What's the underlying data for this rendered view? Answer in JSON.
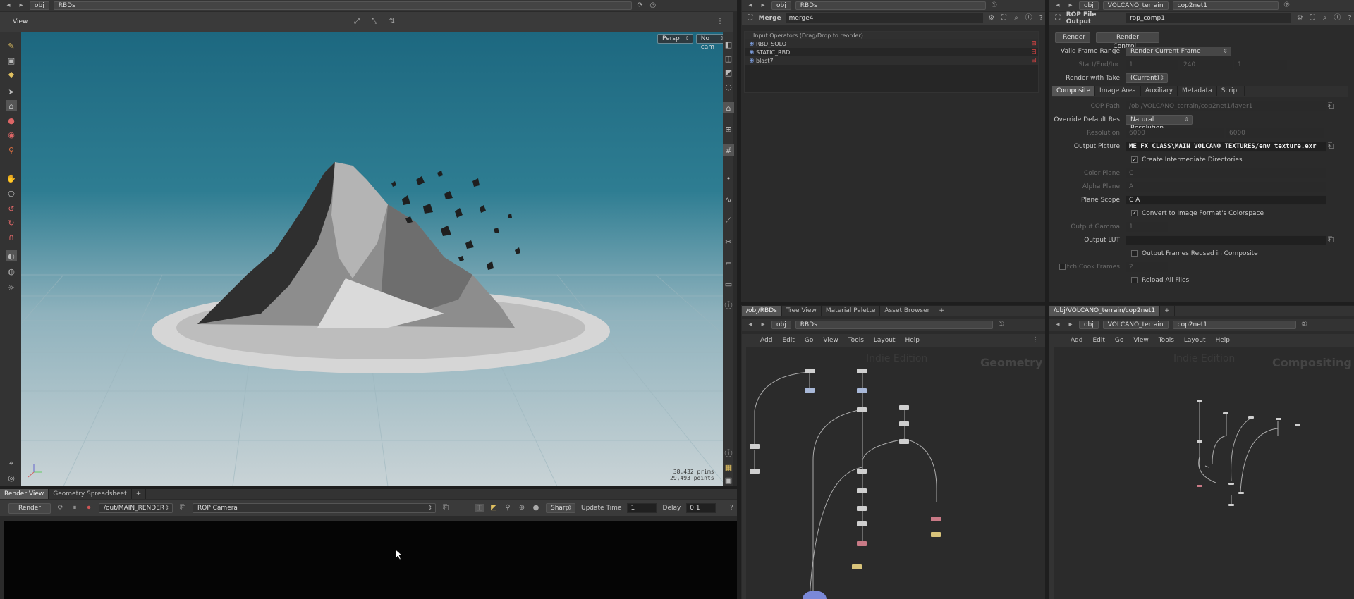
{
  "viewport_pane": {
    "path": [
      "obj",
      "RBDs"
    ],
    "tab_label": "View",
    "persp_label": "Persp",
    "cam_label": "No cam",
    "stats": [
      "38,432  prims",
      "29,493 points"
    ]
  },
  "render_view": {
    "tabs": [
      "Render View",
      "Geometry Spreadsheet"
    ],
    "render_button": "Render",
    "rop_path": "/out/MAIN_RENDER",
    "camera": "ROP Camera",
    "sharp_label": "Sharp",
    "update_time_label": "Update Time",
    "update_time_value": "1",
    "delay_label": "Delay",
    "delay_value": "0.1"
  },
  "merge_pane": {
    "path": [
      "obj",
      "RBDs"
    ],
    "node_type": "Merge",
    "node_name": "merge4",
    "list_header": "Input Operators (Drag/Drop to reorder)",
    "inputs": [
      "RBD_SOLO",
      "STATIC_RBD",
      "blast7"
    ]
  },
  "rop_pane": {
    "path": [
      "obj",
      "VOLCANO_terrain",
      "cop2net1"
    ],
    "node_type": "ROP File Output",
    "node_name": "rop_comp1",
    "render_btn": "Render",
    "render_control_btn": "Render Control...",
    "valid_frame_range_label": "Valid Frame Range",
    "valid_frame_range_value": "Render Current Frame",
    "start_end_label": "Start/End/Inc",
    "start_end_values": [
      "1",
      "240",
      "1"
    ],
    "render_with_take_label": "Render with Take",
    "render_with_take_value": "(Current)",
    "tabs": [
      "Composite",
      "Image Area",
      "Auxiliary",
      "Metadata",
      "Script"
    ],
    "cop_path_label": "COP Path",
    "cop_path_value": "/obj/VOLCANO_terrain/cop2net1/layer1",
    "override_res_label": "Override Default Res",
    "override_res_value": "Natural Resolution",
    "resolution_label": "Resolution",
    "resolution_values": [
      "6000",
      "6000"
    ],
    "output_picture_label": "Output Picture",
    "output_picture_value": "ME_FX_CLASS\\MAIN_VOLCANO_TEXTURES/env_texture.exr",
    "create_dirs_label": "Create Intermediate Directories",
    "color_plane_label": "Color Plane",
    "color_plane_value": "C",
    "alpha_plane_label": "Alpha Plane",
    "alpha_plane_value": "A",
    "plane_scope_label": "Plane Scope",
    "plane_scope_value": "C A",
    "convert_colorspace_label": "Convert to Image Format's Colorspace",
    "output_gamma_label": "Output Gamma",
    "output_gamma_value": "1",
    "output_lut_label": "Output LUT",
    "output_frames_reused_label": "Output Frames Reused in Composite",
    "batch_cook_label": "Batch Cook Frames",
    "batch_cook_value": "2",
    "reload_files_label": "Reload All Files"
  },
  "network_left": {
    "tabs": [
      "/obj/RBDs",
      "Tree View",
      "Material Palette",
      "Asset Browser"
    ],
    "path": [
      "obj",
      "RBDs"
    ],
    "menu": [
      "Add",
      "Edit",
      "Go",
      "View",
      "Tools",
      "Layout",
      "Help"
    ],
    "watermark": "Indie Edition",
    "context": "Geometry"
  },
  "network_right": {
    "tabs": [
      "/obj/VOLCANO_terrain/cop2net1"
    ],
    "path": [
      "obj",
      "VOLCANO_terrain",
      "cop2net1"
    ],
    "menu": [
      "Add",
      "Edit",
      "Go",
      "View",
      "Tools",
      "Layout",
      "Help"
    ],
    "watermark": "Indie Edition",
    "context": "Compositing"
  },
  "colors": {
    "sky_top": "#1d6880",
    "sky_bottom": "#c9d3d6",
    "panel_bg": "#2b2b2b",
    "node_red": "#c97a86",
    "node_yellow": "#d8c37a",
    "node_blue": "#7a88d8"
  }
}
